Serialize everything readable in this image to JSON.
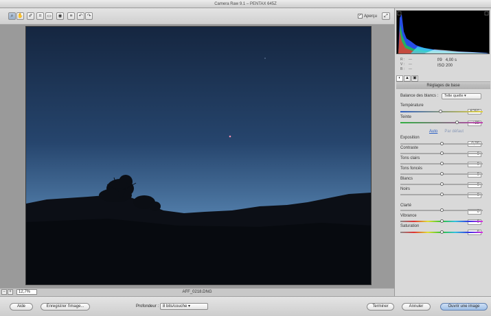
{
  "window": {
    "title": "Camera Raw 9.1  –  PENTAX 645Z"
  },
  "toolbar": {
    "tools": [
      {
        "name": "zoom-tool",
        "glyph": "⌕"
      },
      {
        "name": "hand-tool",
        "glyph": "✋"
      },
      {
        "name": "white-balance-tool",
        "glyph": "✐"
      },
      {
        "name": "crop-tool",
        "glyph": "⌗"
      },
      {
        "name": "straighten-tool",
        "glyph": "▭"
      },
      {
        "name": "redeye-tool",
        "glyph": "◉"
      },
      {
        "name": "preferences-tool",
        "glyph": "≡"
      },
      {
        "name": "rotate-left-tool",
        "glyph": "↶"
      },
      {
        "name": "rotate-right-tool",
        "glyph": "↷"
      }
    ],
    "preview_label": "Aperçu",
    "preview_checked": "✓",
    "fullscreen_glyph": "⤢"
  },
  "status": {
    "zoom_minus": "−",
    "zoom_plus": "+",
    "zoom_value": "12,7%",
    "filename": "AFF_0218.DNG"
  },
  "info": {
    "r": "R :",
    "v": "V :",
    "b": "B :",
    "dash": "---",
    "aperture": "f/9",
    "shutter": "4,00 s",
    "iso": "ISO 200"
  },
  "panel": {
    "section_title": "Réglages de base",
    "wb_label": "Balance des blancs :",
    "wb_value": "Telle quelle",
    "temperature_label": "Température",
    "temperature_value": "6250",
    "tint_label": "Teinte",
    "tint_value": "+28",
    "auto_label": "Auto",
    "default_label": "Par défaut",
    "exposure_label": "Exposition",
    "exposure_value": "0,00",
    "contrast_label": "Contraste",
    "contrast_value": "0",
    "highlights_label": "Tons clairs",
    "highlights_value": "0",
    "shadows_label": "Tons foncés",
    "shadows_value": "0",
    "whites_label": "Blancs",
    "whites_value": "0",
    "blacks_label": "Noirs",
    "blacks_value": "0",
    "clarity_label": "Clarté",
    "clarity_value": "0",
    "vibrance_label": "Vibrance",
    "vibrance_value": "0",
    "saturation_label": "Saturation",
    "saturation_value": "0"
  },
  "bottom": {
    "help_label": "Aide",
    "save_label": "Enregistrer l'image...",
    "depth_label": "Profondeur :",
    "depth_value": "8 bits/couche",
    "done_label": "Terminer",
    "cancel_label": "Annuler",
    "open_label": "Ouvrir une image"
  },
  "colors": {
    "accent": "#2a5fc4",
    "sky_top": "#15263f",
    "sky_horizon": "#4f7aa6"
  }
}
